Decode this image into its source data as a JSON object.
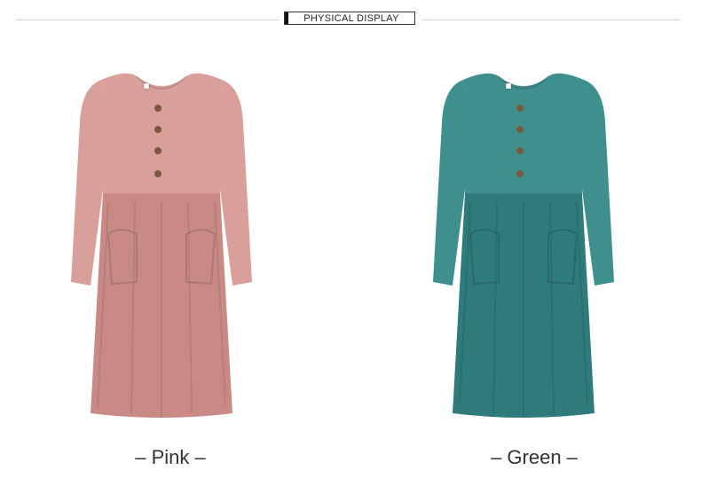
{
  "header": {
    "title": "PHYSICAL DISPLAY"
  },
  "products": [
    {
      "caption": "– Pink –",
      "color": "#d9a09b",
      "shade": "#c98a85"
    },
    {
      "caption": "– Green –",
      "color": "#3f8f8f",
      "shade": "#2f7a7b"
    }
  ],
  "button_color": "#7a5a3e"
}
